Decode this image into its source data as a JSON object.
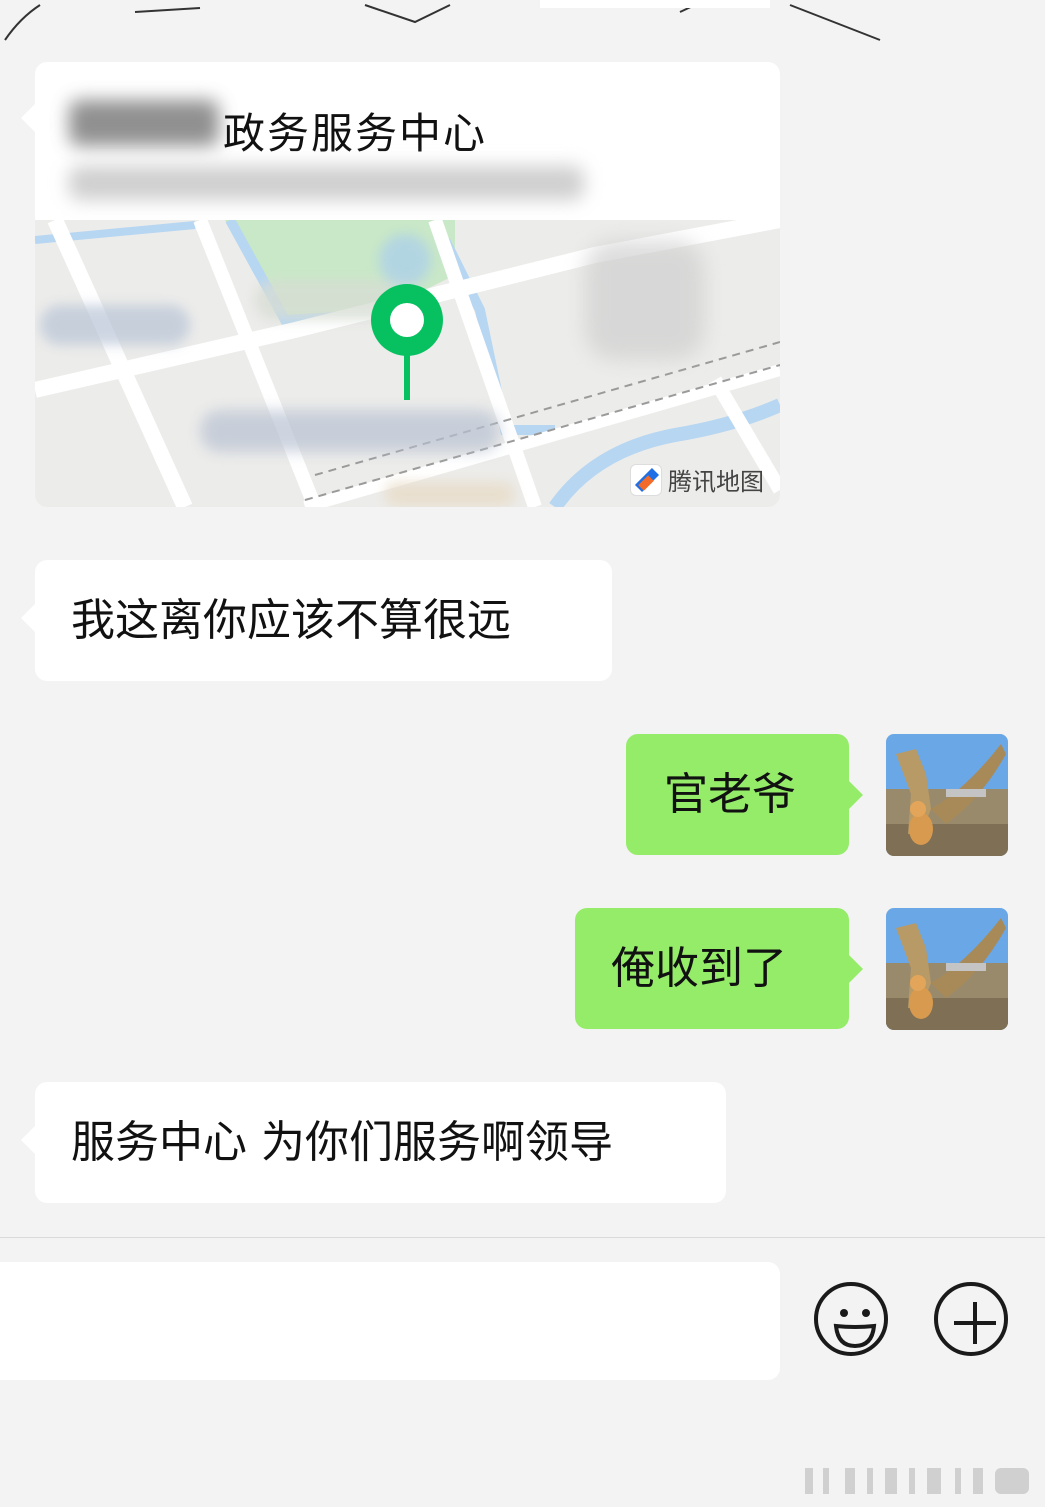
{
  "location_card": {
    "title": "政务服务中心",
    "map_brand": "腾讯地图",
    "map_pin_icon": "location-pin-icon",
    "pin_color": "#07c160"
  },
  "messages": [
    {
      "side": "left",
      "text": "我这离你应该不算很远"
    },
    {
      "side": "right",
      "text": "官老爷"
    },
    {
      "side": "right",
      "text": "俺收到了"
    },
    {
      "side": "left",
      "text": "服务中心 为你们服务啊领导"
    }
  ],
  "input_bar": {
    "emoji_button_icon": "smiley-icon",
    "plus_button_icon": "plus-icon"
  },
  "colors": {
    "background": "#f3f3f3",
    "incoming_bubble": "#ffffff",
    "outgoing_bubble": "#95ec69"
  }
}
